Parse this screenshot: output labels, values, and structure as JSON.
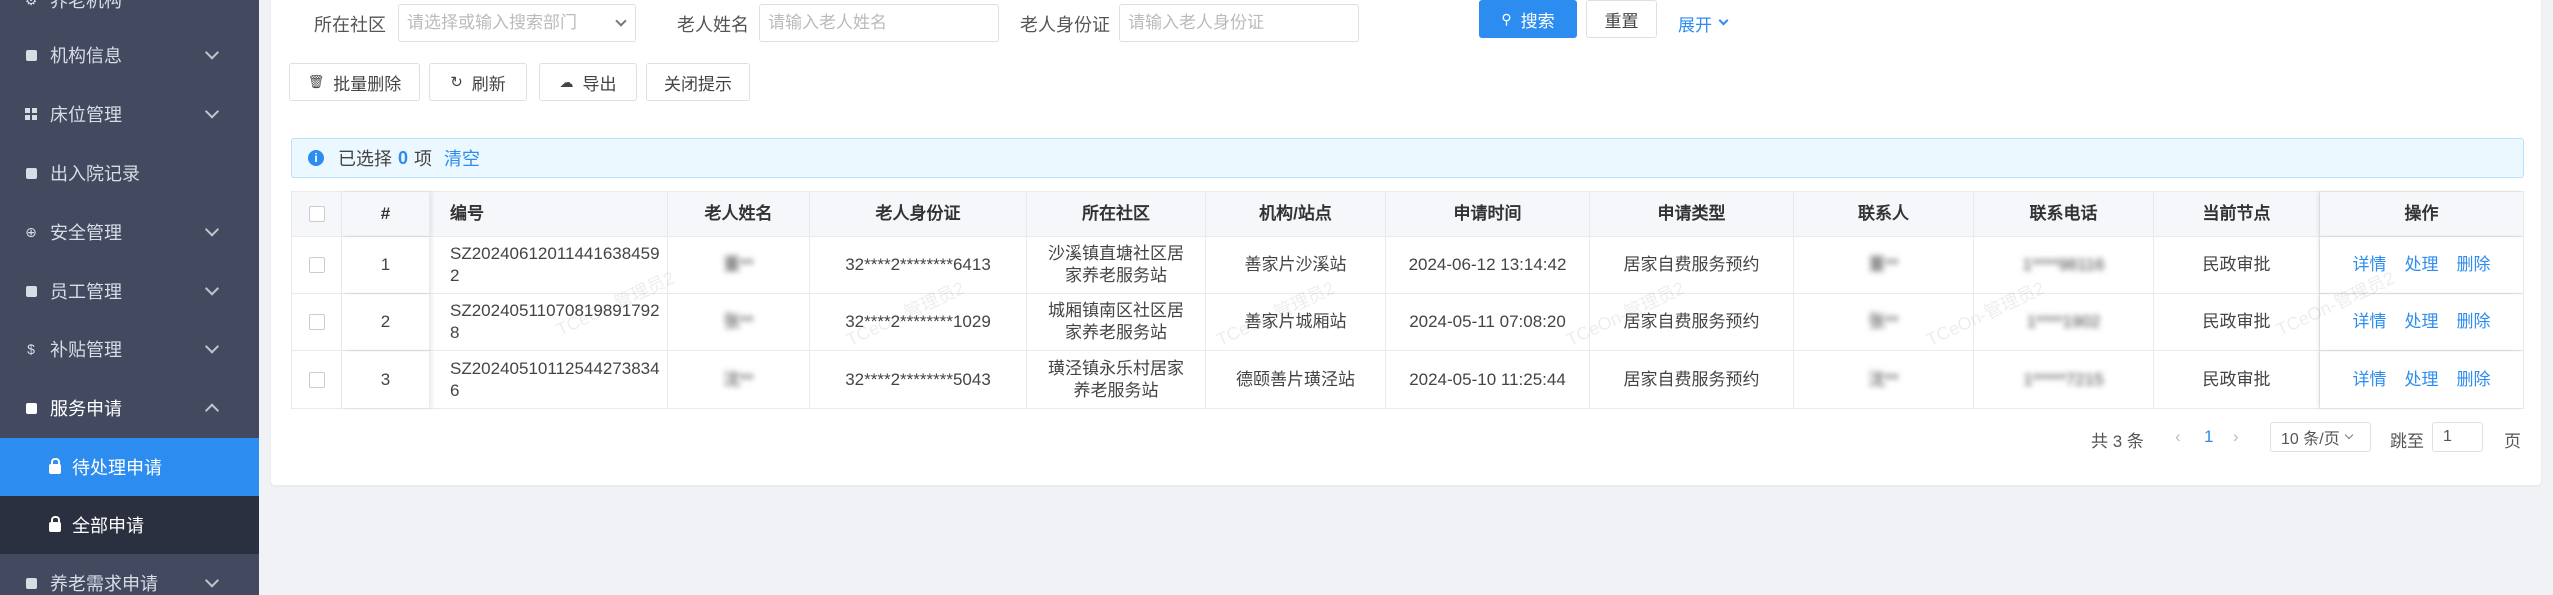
{
  "sidebar": {
    "items": [
      {
        "label": "养老机构",
        "icon": "gear-icon"
      },
      {
        "label": "机构信息",
        "icon": "document-icon"
      },
      {
        "label": "床位管理",
        "icon": "grid-icon"
      },
      {
        "label": "出入院记录",
        "icon": "record-icon"
      },
      {
        "label": "安全管理",
        "icon": "plus-circle-icon"
      },
      {
        "label": "员工管理",
        "icon": "document-icon"
      },
      {
        "label": "补贴管理",
        "icon": "dollar-icon"
      },
      {
        "label": "服务申请",
        "icon": "calendar-icon"
      },
      {
        "label": "养老需求申请",
        "icon": "document-icon"
      }
    ],
    "sub_items": [
      {
        "label": "待处理申请",
        "icon": "lock-icon"
      },
      {
        "label": "全部申请",
        "icon": "lock-icon"
      }
    ]
  },
  "filters": {
    "community_label": "所在社区",
    "community_placeholder": "请选择或输入搜索部门",
    "name_label": "老人姓名",
    "name_placeholder": "请输入老人姓名",
    "id_label": "老人身份证",
    "id_placeholder": "请输入老人身份证",
    "search_label": "搜索",
    "reset_label": "重置",
    "expand_label": "展开"
  },
  "toolbar": {
    "batch_delete": "批量删除",
    "refresh": "刷新",
    "export": "导出",
    "close_tip": "关闭提示"
  },
  "alert": {
    "prefix": "已选择",
    "count": "0",
    "suffix": "项",
    "clear": "清空"
  },
  "table": {
    "headers": [
      "#",
      "编号",
      "老人姓名",
      "老人身份证",
      "所在社区",
      "机构/站点",
      "申请时间",
      "申请类型",
      "联系人",
      "联系电话",
      "当前节点",
      "操作"
    ],
    "rows": [
      {
        "index": "1",
        "code": "SZ202406120114416384592",
        "name": "董**",
        "id_card": "32****2********6413",
        "community": "沙溪镇直塘社区居家养老服务站",
        "station": "善家片沙溪站",
        "time": "2024-06-12 13:14:42",
        "type": "居家自费服务预约",
        "contact": "董**",
        "phone": "1****98116",
        "node": "民政审批"
      },
      {
        "index": "2",
        "code": "SZ202405110708198917928",
        "name": "张**",
        "id_card": "32****2********1029",
        "community": "城厢镇南区社区居家养老服务站",
        "station": "善家片城厢站",
        "time": "2024-05-11 07:08:20",
        "type": "居家自费服务预约",
        "contact": "张**",
        "phone": "1****1902",
        "node": "民政审批"
      },
      {
        "index": "3",
        "code": "SZ202405101125442738346",
        "name": "沈**",
        "id_card": "32****2********5043",
        "community": "璜泾镇永乐村居家养老服务站",
        "station": "德颐善片璜泾站",
        "time": "2024-05-10 11:25:44",
        "type": "居家自费服务预约",
        "contact": "沈**",
        "phone": "1*****7215",
        "node": "民政审批"
      }
    ],
    "actions": [
      "详情",
      "处理",
      "删除"
    ]
  },
  "pagination": {
    "total": "共 3 条",
    "current": "1",
    "page_size": "10 条/页",
    "jump_label": "跳至",
    "jump_value": "1",
    "page_unit": "页"
  },
  "watermark": "TCeOn-管理员2",
  "colors": {
    "sidebar_bg": "#434a5f",
    "sidebar_active": "#2d8cf0",
    "primary": "#2d8cf0"
  }
}
